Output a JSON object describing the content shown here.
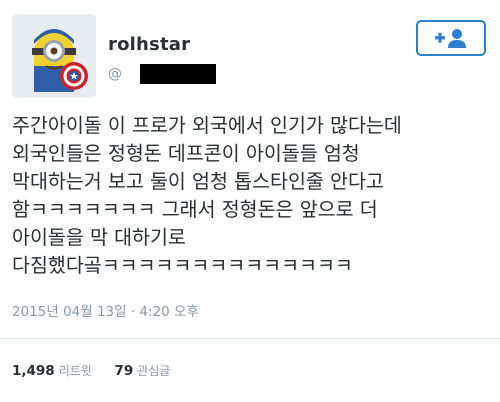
{
  "user": {
    "display_name": "rolhstar",
    "handle_prefix": "@"
  },
  "follow_button": {
    "icon": "follow-icon"
  },
  "tweet": {
    "text": "주간아이돌 이 프로가 외국에서 인기가 많다는데\n외국인들은 정형돈 데프콘이 아이돌들 엄청\n막대하는거 보고 둘이 엄청 톱스타인줄 안다고\n함ㅋㅋㅋㅋㅋㅋㅋ 그래서 정형돈은 앞으로 더\n아이돌을 막 대하기로\n다짐했다곸ㅋㅋㅋㅋㅋㅋㅋㅋㅋㅋㅋㅋㅋㅋ",
    "timestamp": "2015년 04월 13일 · 4:20 오후"
  },
  "stats": {
    "retweets_count": "1,498",
    "retweets_label": "리트윗",
    "likes_count": "79",
    "likes_label": "관심글"
  },
  "colors": {
    "accent": "#2f7fd1",
    "text": "#292f33",
    "muted": "#8899a6"
  }
}
